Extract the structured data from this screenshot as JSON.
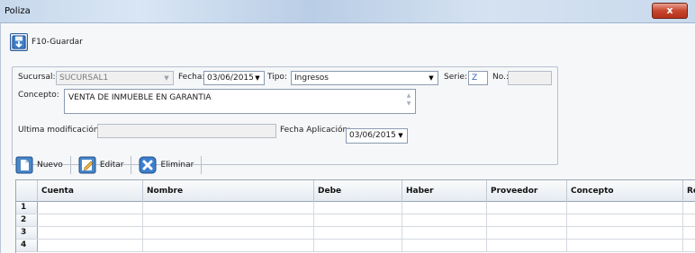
{
  "window": {
    "title": "Poliza",
    "close_label": "x"
  },
  "toolbar": {
    "save_label": "F10-Guardar"
  },
  "form": {
    "sucursal": {
      "label": "Sucursal:",
      "value": "SUCURSAL1"
    },
    "fecha": {
      "label": "Fecha:",
      "value": "03/06/2015"
    },
    "tipo": {
      "label": "Tipo:",
      "value": "Ingresos"
    },
    "serie": {
      "label": "Serie:",
      "value": "Z"
    },
    "numero": {
      "label": "No.:",
      "value": ""
    },
    "concepto": {
      "label": "Concepto:",
      "value": "VENTA DE INMUEBLE EN GARANTIA"
    },
    "ultima_modificacion": {
      "label": "Ultima modificación:",
      "value": ""
    },
    "fecha_aplicacion": {
      "label": "Fecha Aplicación:",
      "value": "03/06/2015"
    }
  },
  "grid_toolbar": {
    "nuevo_label": "Nuevo",
    "editar_label": "Editar",
    "eliminar_label": "Eliminar"
  },
  "grid": {
    "columns": [
      "Cuenta",
      "Nombre",
      "Debe",
      "Haber",
      "Proveedor",
      "Concepto",
      "Re"
    ],
    "rows": [
      "1",
      "2",
      "3",
      "4"
    ]
  }
}
